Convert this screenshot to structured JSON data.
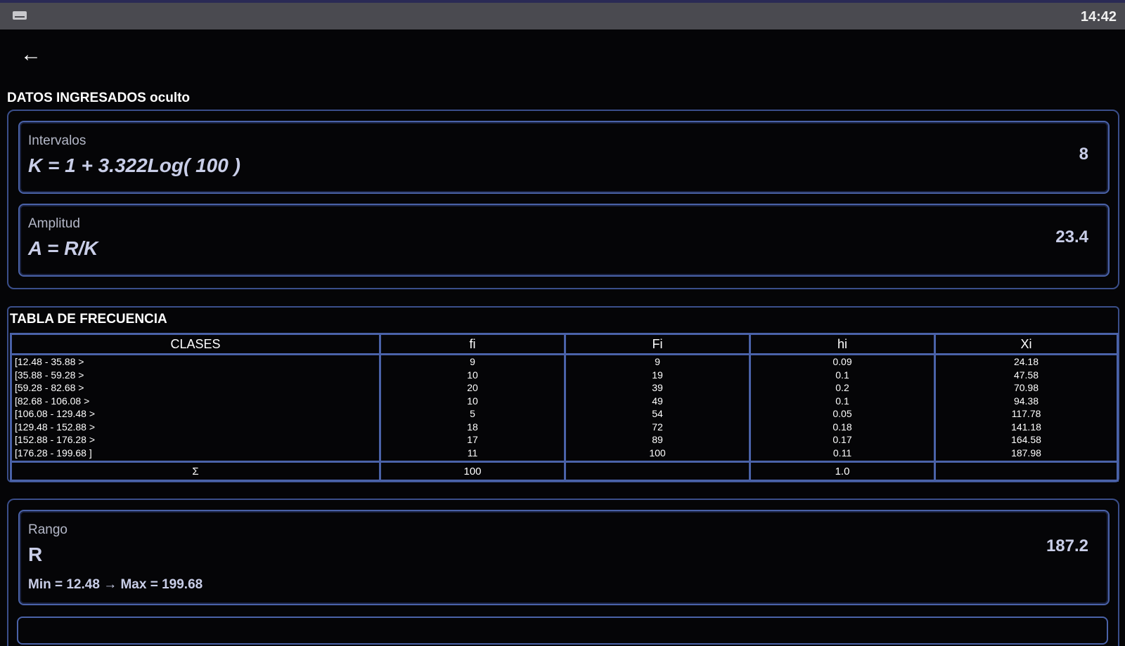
{
  "status": {
    "time": "14:42",
    "keyboard_icon": "keyboard-icon"
  },
  "nav": {
    "back_icon": "←"
  },
  "datos": {
    "title": "DATOS INGRESADOS oculto",
    "intervalos": {
      "label": "Intervalos",
      "formula": "K = 1 + 3.322Log( 100 )",
      "value": "8"
    },
    "amplitud": {
      "label": "Amplitud",
      "formula": "A = R/K",
      "value": "23.4"
    }
  },
  "tabla": {
    "title": "TABLA DE FRECUENCIA",
    "headers": [
      "CLASES",
      "fi",
      "Fi",
      "hi",
      "Xi"
    ],
    "rows": [
      [
        "[12.48 - 35.88 >",
        "9",
        "9",
        "0.09",
        "24.18"
      ],
      [
        "[35.88 - 59.28 >",
        "10",
        "19",
        "0.1",
        "47.58"
      ],
      [
        "[59.28 - 82.68 >",
        "20",
        "39",
        "0.2",
        "70.98"
      ],
      [
        "[82.68 - 106.08 >",
        "10",
        "49",
        "0.1",
        "94.38"
      ],
      [
        "[106.08 - 129.48 >",
        "5",
        "54",
        "0.05",
        "117.78"
      ],
      [
        "[129.48 - 152.88 >",
        "18",
        "72",
        "0.18",
        "141.18"
      ],
      [
        "[152.88 - 176.28 >",
        "17",
        "89",
        "0.17",
        "164.58"
      ],
      [
        "[176.28 - 199.68 ]",
        "11",
        "100",
        "0.11",
        "187.98"
      ]
    ],
    "totals": [
      "Σ",
      "100",
      "",
      "1.0",
      ""
    ]
  },
  "rango": {
    "label": "Rango",
    "formula": "R",
    "detail": "Min = 12.48 → Max = 199.68",
    "value": "187.2"
  }
}
